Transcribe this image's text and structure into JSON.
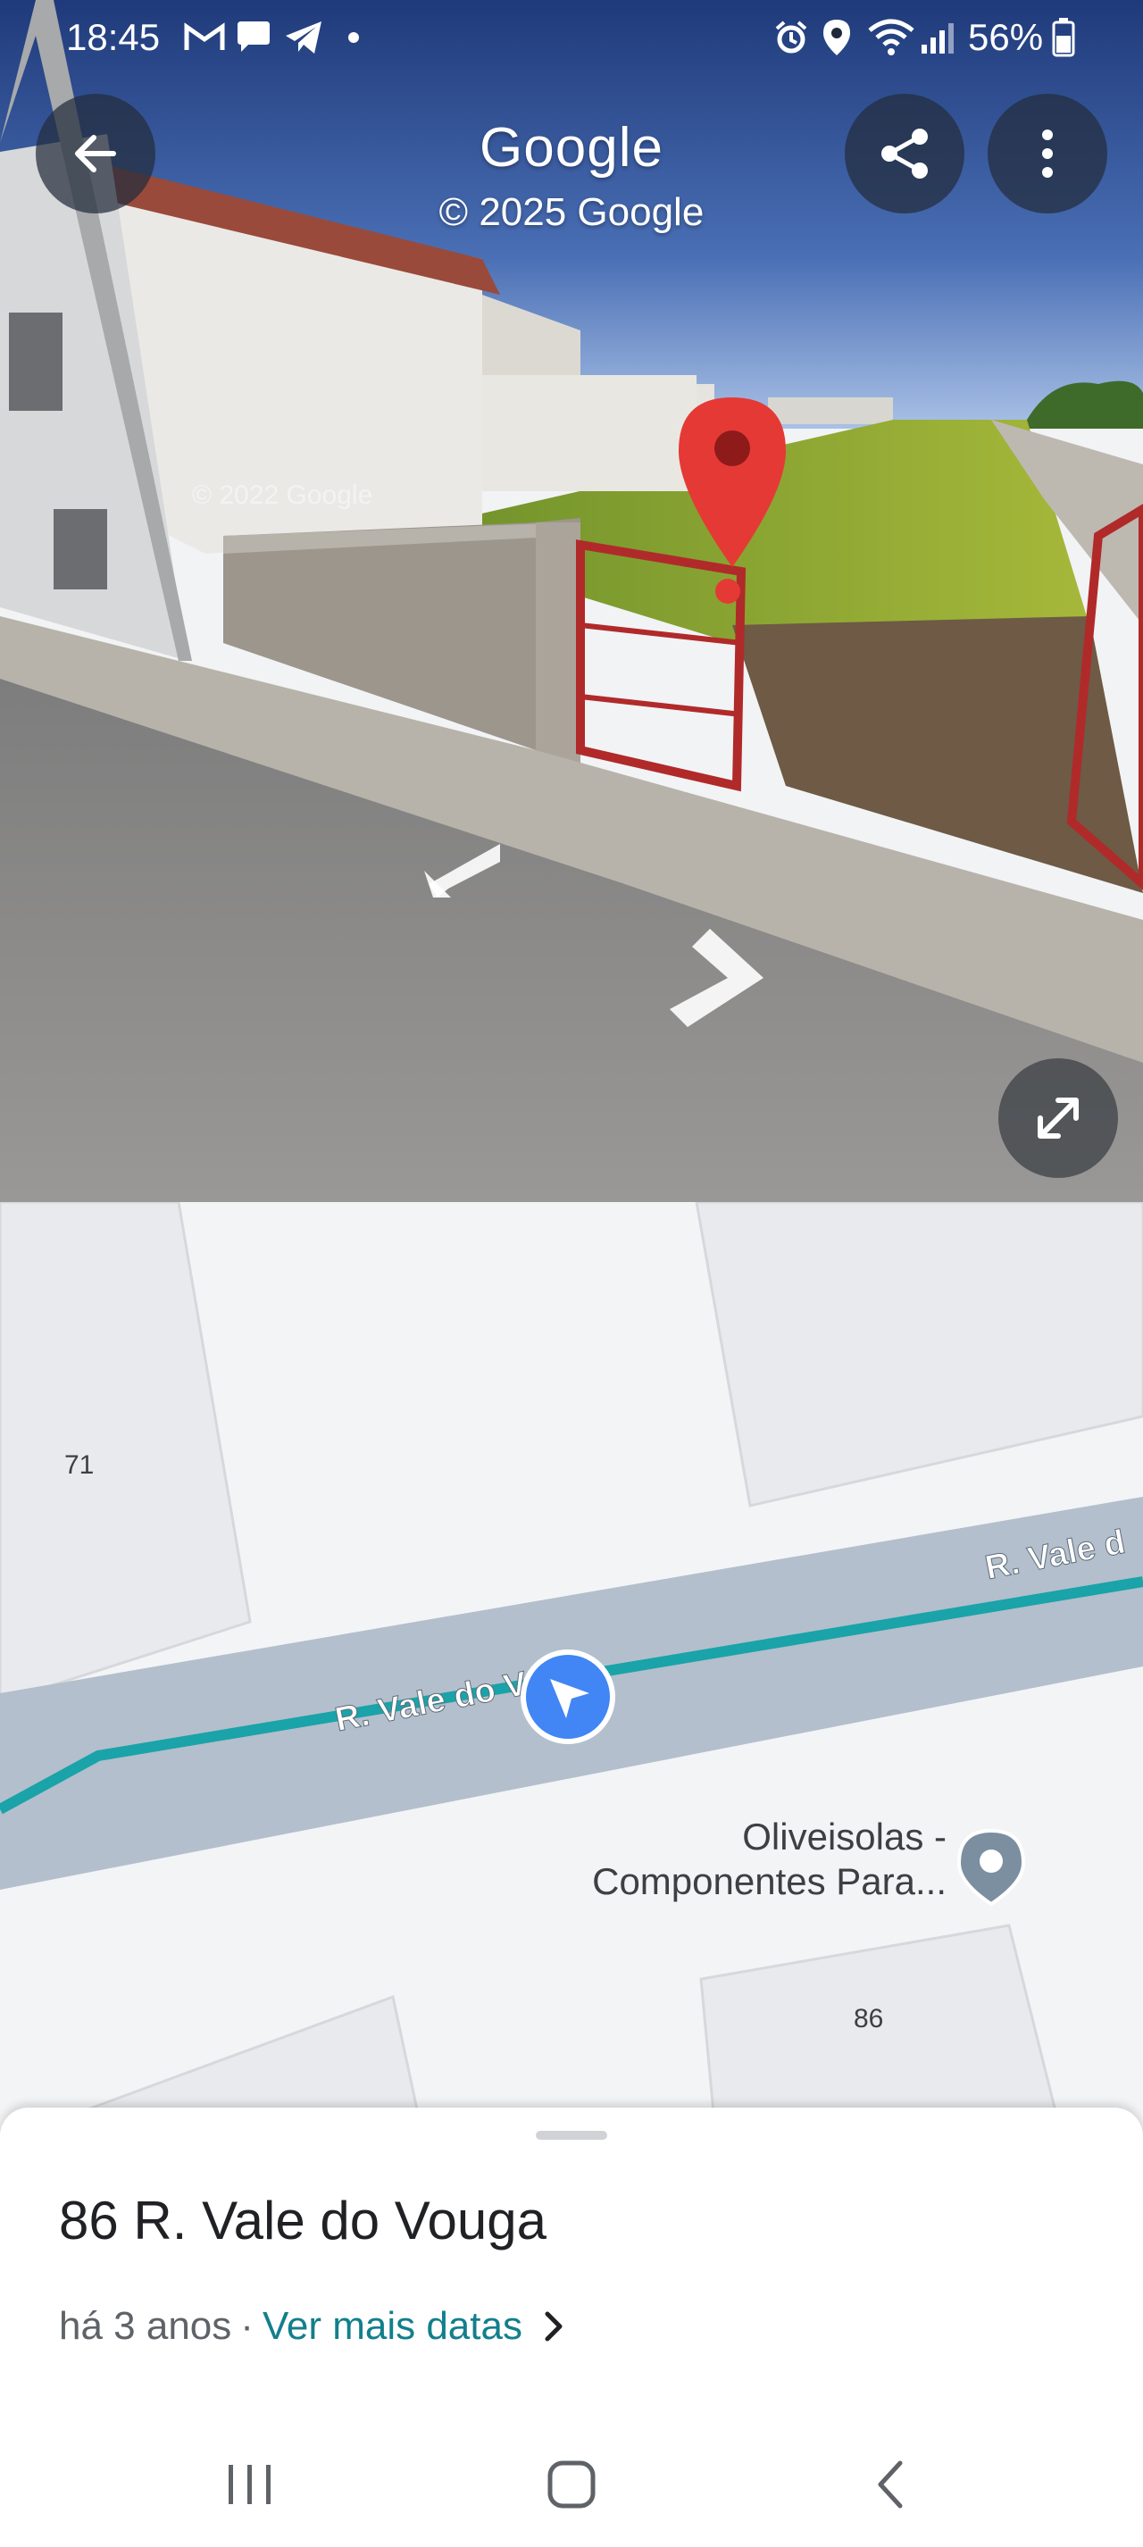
{
  "status_bar": {
    "time": "18:45",
    "battery": "56%",
    "left_icons": [
      "gmail-icon",
      "chat-bubble-icon",
      "telegram-icon",
      "dot-icon"
    ],
    "right_icons": [
      "alarm-icon",
      "location-icon",
      "wifi-icon",
      "signal-icon",
      "battery-icon"
    ]
  },
  "header": {
    "title": "Google",
    "copyright": "© 2025 Google",
    "back_icon": "back-arrow-icon",
    "share_icon": "share-icon",
    "more_icon": "more-vert-icon"
  },
  "streetview": {
    "watermark": "© 2022 Google",
    "expand_icon": "expand-icon",
    "pin_color": "#e53935"
  },
  "map": {
    "street_name": "R. Vale do Vouga",
    "street_name_right": "R. Vale d",
    "place_name_line1": "Oliveisolas -",
    "place_name_line2": "Componentes Para...",
    "building_numbers": [
      "71",
      "86"
    ],
    "route_color": "#1aa3a8",
    "location_color": "#4285f4"
  },
  "bottom_sheet": {
    "address": "86 R. Vale do Vouga",
    "age": "há 3 anos",
    "separator": "·",
    "more_dates_link": "Ver mais datas",
    "link_color": "#127f8c"
  },
  "nav_bar": {
    "icons": [
      "recents-icon",
      "home-icon",
      "back-icon"
    ]
  }
}
